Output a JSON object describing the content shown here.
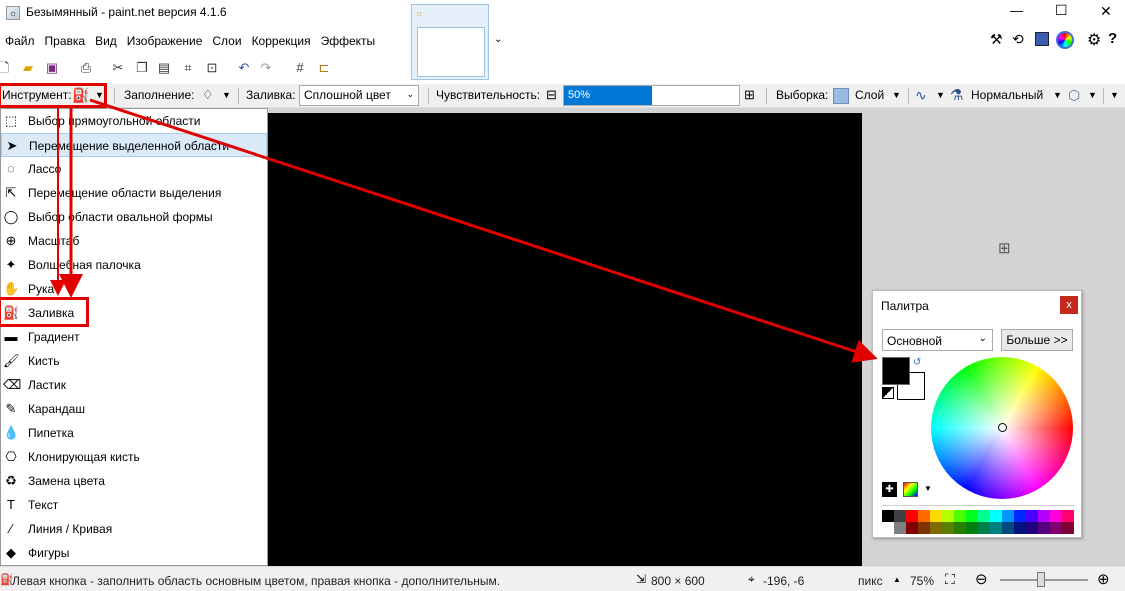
{
  "window": {
    "title": "Безымянный - paint.net версия 4.1.6",
    "controls": {
      "minimize": "—",
      "maximize": "☐",
      "close": "✕"
    }
  },
  "menu": [
    "Файл",
    "Правка",
    "Вид",
    "Изображение",
    "Слои",
    "Коррекция",
    "Эффекты"
  ],
  "toolbar2": {
    "tool_label": "Инструмент:",
    "fill_mode_label": "Заполнение:",
    "flood_label": "Заливка:",
    "flood_value": "Сплошной цвет",
    "sensitivity_label": "Чувствительность:",
    "sensitivity_value": "50%",
    "sensitivity_fraction": 0.5,
    "selection_label": "Выборка:",
    "selection_value": "Слой",
    "blend_value": "Нормальный",
    "minus": "⊟",
    "plus": "⊞"
  },
  "tools": [
    {
      "label": "Выбор прямоугольной области",
      "icon": "rect-select-icon"
    },
    {
      "label": "Перемещение выделенной области",
      "icon": "move-selection-icon"
    },
    {
      "label": "Лассо",
      "icon": "lasso-icon"
    },
    {
      "label": "Перемещение области выделения",
      "icon": "move-selection-area-icon"
    },
    {
      "label": "Выбор области овальной формы",
      "icon": "ellipse-select-icon"
    },
    {
      "label": "Масштаб",
      "icon": "zoom-icon"
    },
    {
      "label": "Волшебная палочка",
      "icon": "magic-wand-icon"
    },
    {
      "label": "Рука",
      "icon": "hand-icon"
    },
    {
      "label": "Заливка",
      "icon": "paint-bucket-icon"
    },
    {
      "label": "Градиент",
      "icon": "gradient-icon"
    },
    {
      "label": "Кисть",
      "icon": "brush-icon"
    },
    {
      "label": "Ластик",
      "icon": "eraser-icon"
    },
    {
      "label": "Карандаш",
      "icon": "pencil-icon"
    },
    {
      "label": "Пипетка",
      "icon": "color-picker-icon"
    },
    {
      "label": "Клонирующая кисть",
      "icon": "clone-stamp-icon"
    },
    {
      "label": "Замена цвета",
      "icon": "recolor-icon"
    },
    {
      "label": "Текст",
      "icon": "text-icon"
    },
    {
      "label": "Линия / Кривая",
      "icon": "line-curve-icon"
    },
    {
      "label": "Фигуры",
      "icon": "shapes-icon"
    }
  ],
  "palette": {
    "title": "Палитра",
    "close": "x",
    "mode": "Основной",
    "more_button": "Больше >>",
    "primary_color": "#000000",
    "secondary_color": "#ffffff"
  },
  "status": {
    "hint": "Левая кнопка - заполнить область основным цветом, правая кнопка - дополнительным.",
    "image_size": "800 × 600",
    "cursor_pos": "-196, -6",
    "units": "пикс",
    "zoom": "75%"
  },
  "colors": {
    "accent_red": "#e00000",
    "highlight": "#dbeaf7",
    "progress": "#0078d7"
  }
}
